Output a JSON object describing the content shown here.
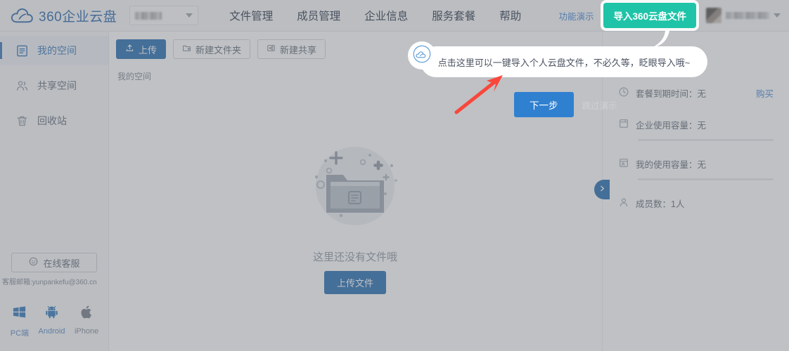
{
  "header": {
    "logo_text": "360企业云盘",
    "logo_icon": "cloud-icon",
    "enterprise_select": {
      "value": "",
      "caret_icon": "chevron-down-icon"
    },
    "nav": [
      {
        "label": "文件管理"
      },
      {
        "label": "成员管理"
      },
      {
        "label": "企业信息"
      },
      {
        "label": "服务套餐"
      },
      {
        "label": "帮助"
      }
    ],
    "demo_link": "功能演示",
    "import_button": "导入360云盘文件",
    "user": {
      "name": "",
      "avatar_icon": "avatar",
      "caret_icon": "chevron-down-icon"
    }
  },
  "sidebar": {
    "items": [
      {
        "label": "我的空间",
        "icon": "document-list-icon",
        "active": true
      },
      {
        "label": "共享空间",
        "icon": "users-icon",
        "active": false
      },
      {
        "label": "回收站",
        "icon": "trash-icon",
        "active": false
      }
    ],
    "support_button": "在线客服",
    "support_icon": "headset-icon",
    "support_mail": "客服邮箱:yunpankefu@360.cn",
    "platforms": [
      {
        "label": "PC端",
        "icon": "windows-icon"
      },
      {
        "label": "Android",
        "icon": "android-icon"
      },
      {
        "label": "iPhone",
        "icon": "apple-icon"
      }
    ]
  },
  "main": {
    "toolbar": [
      {
        "label": "上传",
        "icon": "upload-icon",
        "style": "primary"
      },
      {
        "label": "新建文件夹",
        "icon": "folder-plus-icon",
        "style": "plain"
      },
      {
        "label": "新建共享",
        "icon": "share-icon",
        "style": "plain"
      }
    ],
    "breadcrumb": "我的空间",
    "empty_state": {
      "illustration": "empty-folder-illustration",
      "text": "这里还没有文件哦",
      "button": "上传文件"
    }
  },
  "right_panel": {
    "rows": [
      {
        "icon": "clock-icon",
        "label": "套餐到期时间：无",
        "link": "购买",
        "bar": false
      },
      {
        "icon": "enterprise-storage-icon",
        "label": "企业使用容量：无",
        "link": "",
        "bar": true
      },
      {
        "icon": "my-storage-icon",
        "label": "我的使用容量：无",
        "link": "",
        "bar": true
      },
      {
        "icon": "user-icon",
        "label": "成员数：1人",
        "link": "",
        "bar": false
      }
    ],
    "collapse_icon": "chevron-right-icon"
  },
  "tour": {
    "avatar_icon": "cloud-mascot-icon",
    "tip_text": "点击这里可以一键导入个人云盘文件，不必久等，眨眼导入哦~",
    "next_button": "下一步",
    "skip_button": "跳过演示",
    "pointer_icon": "red-arrow-icon"
  },
  "colors": {
    "brand_blue": "#1b5ea8",
    "accent_green": "#1fc4a8",
    "primary_button": "#1765ad",
    "link_blue": "#3b7fd4",
    "pointer_red": "#f9473c",
    "page_bg": "#ffffff",
    "chrome_bg": "#f7f8fa"
  }
}
